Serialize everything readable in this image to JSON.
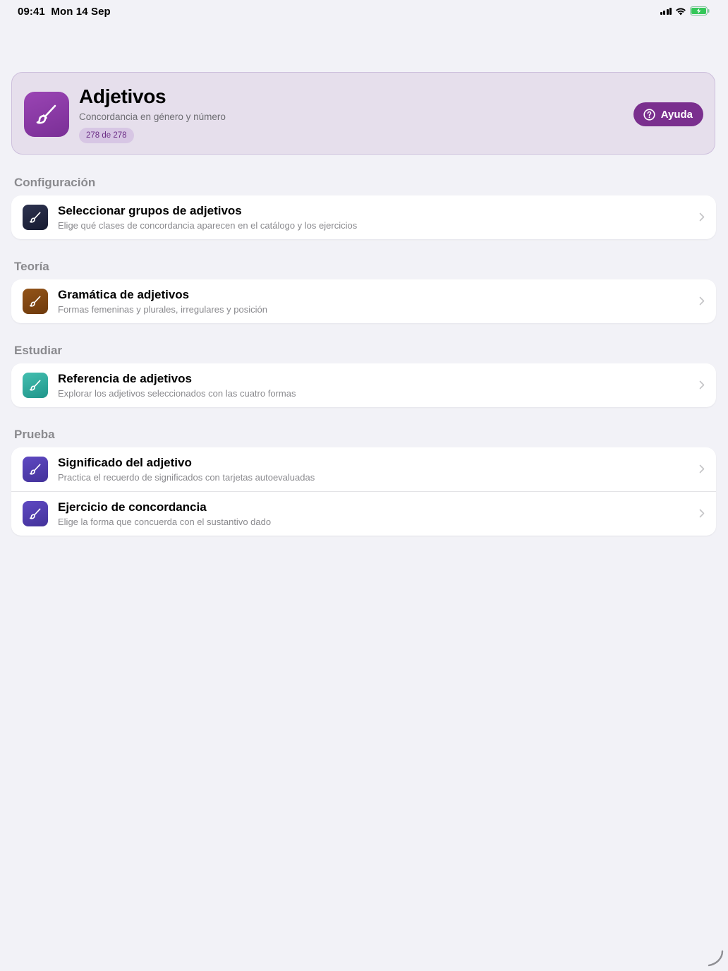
{
  "status": {
    "time": "09:41",
    "date": "Mon 14 Sep",
    "icons": [
      "cellular-signal-icon",
      "wifi-icon",
      "battery-charging-icon"
    ]
  },
  "hero": {
    "icon": "paintbrush-icon",
    "title": "Adjetivos",
    "subtitle": "Concordancia en género y número",
    "count": "278 de 278",
    "help_label": "Ayuda",
    "help_icon": "question-circle-icon"
  },
  "sections": [
    {
      "title": "Configuración",
      "rows": [
        {
          "title": "Seleccionar grupos de adjetivos",
          "subtitle": "Elige qué clases de concordancia aparecen en el catálogo y los ejercicios",
          "icon": "paintbrush-icon"
        }
      ]
    },
    {
      "title": "Teoría",
      "rows": [
        {
          "title": "Gramática de adjetivos",
          "subtitle": "Formas femeninas y plurales, irregulares y posición",
          "icon": "paintbrush-icon"
        }
      ]
    },
    {
      "title": "Estudiar",
      "rows": [
        {
          "title": "Referencia de adjetivos",
          "subtitle": "Explorar los adjetivos seleccionados con las cuatro formas",
          "icon": "paintbrush-icon"
        }
      ]
    },
    {
      "title": "Prueba",
      "rows": [
        {
          "title": "Significado del adjetivo",
          "subtitle": "Practica el recuerdo de significados con tarjetas autoevaluadas",
          "icon": "paintbrush-icon"
        },
        {
          "title": "Ejercicio de concordancia",
          "subtitle": "Elige la forma que concuerda con el sustantivo dado",
          "icon": "paintbrush-icon"
        }
      ]
    }
  ],
  "colors": {
    "accent": "#7a2f8e",
    "config_icon": "#1f2440",
    "theory_icon": "#7a4412",
    "study_icon": "#2aa399",
    "test_icon": "#4e3aa8"
  }
}
